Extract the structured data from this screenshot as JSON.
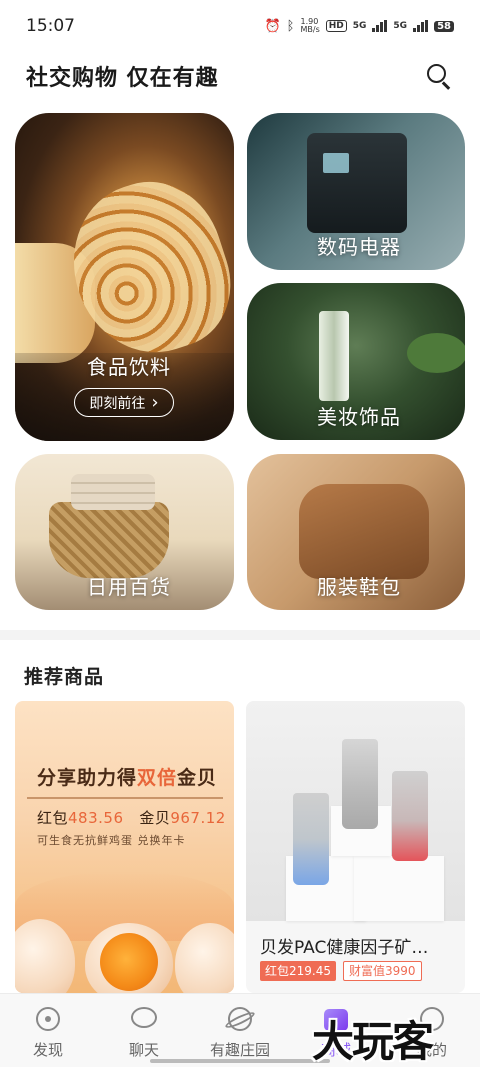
{
  "status_bar": {
    "time": "15:07",
    "speed": "1.90",
    "speed_unit": "MB/s",
    "hd": "HD",
    "net1": "5G",
    "net2": "5G",
    "battery": "58"
  },
  "header": {
    "title": "社交购物 仅在有趣",
    "search_icon": "search-icon"
  },
  "categories": [
    {
      "label": "食品饮料",
      "button": "即刻前往",
      "button_arrow": "›"
    },
    {
      "label": "数码电器"
    },
    {
      "label": "美妆饰品"
    },
    {
      "label": "日用百货"
    },
    {
      "label": "服装鞋包"
    }
  ],
  "section": {
    "title": "推荐商品"
  },
  "promo": {
    "headline_a": "分享助力得",
    "headline_b": "双倍",
    "headline_c": "金贝",
    "amount_1_label": "红包",
    "amount_1_value": "483.56",
    "amount_2_label": "金贝",
    "amount_2_value": "967.12",
    "subtitle": "可生食无抗鲜鸡蛋 兑换年卡"
  },
  "product": {
    "name": "贝发PAC健康因子矿…",
    "tag_red": "红包219.45",
    "tag_wealth": "财富值3990"
  },
  "bottom_nav": [
    {
      "label": "发现",
      "icon": "discover-icon"
    },
    {
      "label": "聊天",
      "icon": "chat-icon"
    },
    {
      "label": "有趣庄园",
      "icon": "planet-icon"
    },
    {
      "label": "商城",
      "icon": "shopping-bag-icon",
      "active": true
    },
    {
      "label": "我的",
      "icon": "profile-icon"
    }
  ],
  "watermark": "大玩客",
  "colors": {
    "accent": "#8b5cf6",
    "price_red": "#ef6c54",
    "promo_orange": "#e8663a"
  }
}
